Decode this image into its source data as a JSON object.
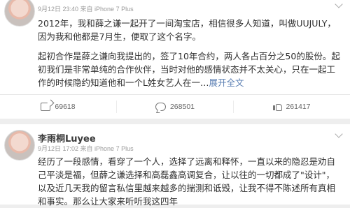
{
  "post1": {
    "meta": "9月12日 23:40 来自 iPhone 7 Plus",
    "paragraph1": "2012年，我和薛之谦一起开了一间淘宝店，相信很多人知道，叫做UUJULY，因为我和他都是7月生，便取了这个名字。",
    "paragraph2_prefix": "起初合作是薛之谦向我提出的，签了10年合约，两人各占百分之50的股份。起初我们是非常单纯的合作伙伴，当时对他的感情状态并不太关心，只在一起工作的时候隐约知道他和一个L姓女艺人在一…",
    "expand_label": "展开全文",
    "actions": {
      "shares": "69618",
      "comments": "268501",
      "likes": "261417"
    }
  },
  "post2": {
    "username": "李雨桐Luyee",
    "meta": "9月12日 17:02 来自 iPhone 7 Plus",
    "body": "经历了一段感情，看穿了一个人，选择了远离和释怀，一直以来的隐忍是劝自己平淡是福，但薛之谦选择和高磊鑫高调复合，让以往的一切都成了\"设计\"，以及近几天我的留言私信里越来越多的揣测和诋毁，让我不得不陈述所有真相和事实。那么让大家来听听我这四年"
  }
}
